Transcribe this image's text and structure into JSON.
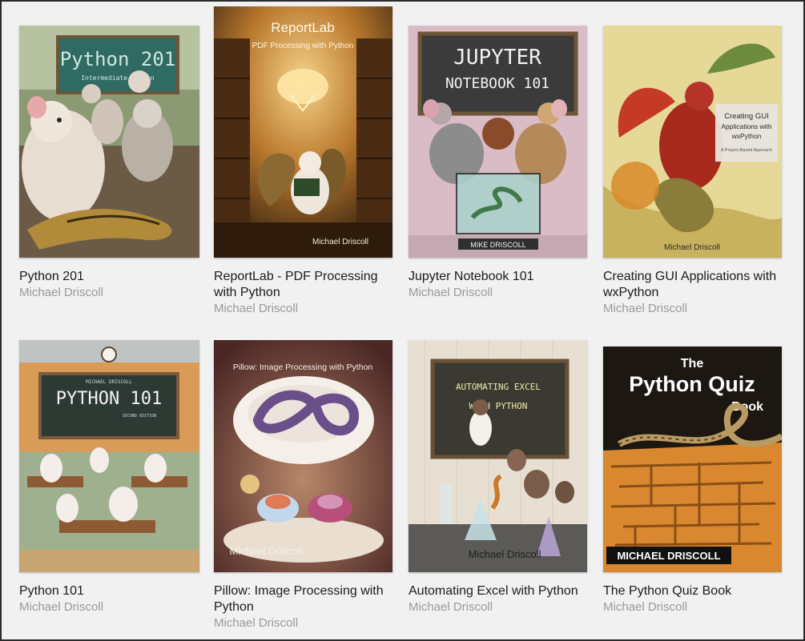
{
  "books": [
    {
      "title": "Python 201",
      "author": "Michael Driscoll",
      "cover": {
        "heading": "Python 201",
        "subheading": "Intermediate Python",
        "illustration": "rats-in-classroom",
        "colors": {
          "bg": "#7a8f6a",
          "board": "#2f6a63",
          "chalk": "#cfe9df"
        }
      }
    },
    {
      "title": "ReportLab - PDF Processing with Python",
      "author": "Michael Driscoll",
      "cover": {
        "heading": "ReportLab",
        "subheading": "PDF Processing with Python",
        "byline": "Michael Driscoll",
        "illustration": "mouse-reading-in-library",
        "colors": {
          "bg": "#3a2410",
          "glow": "#f3c26a"
        }
      }
    },
    {
      "title": "Jupyter Notebook 101",
      "author": "Michael Driscoll",
      "cover": {
        "heading_line1": "JUPYTER",
        "heading_line2": "NOTEBOOK 101",
        "byline": "MIKE DRISCOLL",
        "illustration": "two-mice-with-snake-tank",
        "colors": {
          "bg": "#d7b8c3",
          "board": "#3b3b3b",
          "chalk": "#f2f2f2"
        }
      }
    },
    {
      "title": "Creating GUI Applications with wxPython",
      "author": "Michael Driscoll",
      "cover": {
        "heading_line1": "Creating GUI",
        "heading_line2": "Applications with",
        "heading_line3": "wxPython",
        "subheading": "A Project-Based Approach",
        "byline": "Michael Driscoll",
        "illustration": "dragon-and-snake",
        "colors": {
          "bg": "#e9dc9a",
          "accent": "#b8281c"
        }
      }
    },
    {
      "title": "Python 101",
      "author": "Michael Driscoll",
      "cover": {
        "heading": "PYTHON 101",
        "small_top": "MICHAEL DRISCOLL",
        "small_bottom": "SECOND EDITION",
        "illustration": "mice-classroom",
        "colors": {
          "bg": "#d79b57",
          "board": "#2d3a34",
          "chalk": "#f3f3f3"
        }
      }
    },
    {
      "title": "Pillow: Image Processing with Python",
      "author": "Michael Driscoll",
      "cover": {
        "heading": "Pillow: Image Processing with Python",
        "byline": "Michael Driscoll",
        "illustration": "sleeping-mice-dreaming-snake",
        "colors": {
          "bg": "#5a2f2c",
          "cloud": "#f4efe8"
        }
      }
    },
    {
      "title": "Automating Excel with Python",
      "author": "Michael Driscoll",
      "cover": {
        "heading_line1": "AUTOMATING EXCEL",
        "heading_line2": "WITH PYTHON",
        "byline": "Michael Driscoll",
        "illustration": "mice-in-lab",
        "colors": {
          "bg": "#e8e1d3",
          "board": "#3a3a32",
          "chalk": "#f2e9a6"
        }
      }
    },
    {
      "title": "The Python Quiz Book",
      "author": "Michael Driscoll",
      "cover": {
        "heading_line1": "The",
        "heading_line2": "Python Quiz",
        "heading_line3": "Book",
        "byline": "MICHAEL DRISCOLL",
        "illustration": "snake-over-maze",
        "colors": {
          "bg": "#1d1712",
          "maze": "#d9882f"
        }
      }
    }
  ]
}
